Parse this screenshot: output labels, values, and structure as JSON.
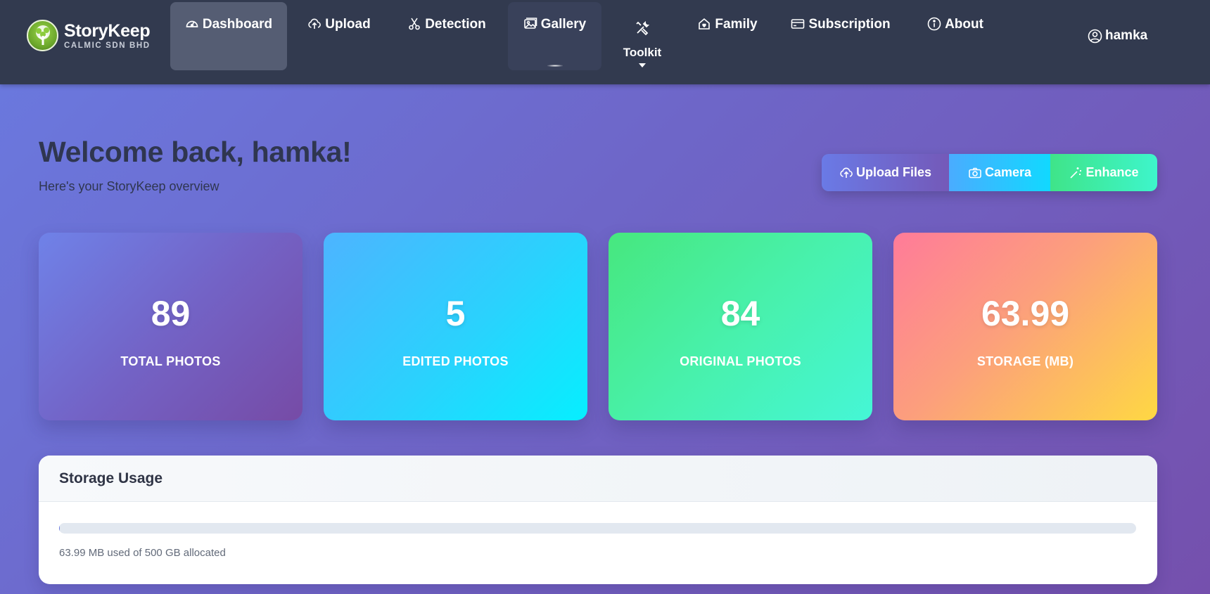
{
  "brand": {
    "name": "StoryKeep",
    "subtitle": "CALMIC SDN BHD",
    "logo_icon": "tree-icon"
  },
  "nav": {
    "items": [
      {
        "label": "Dashboard",
        "icon": "gauge-icon",
        "state": "active"
      },
      {
        "label": "Upload",
        "icon": "cloud-upload-icon"
      },
      {
        "label": "Detection",
        "icon": "scissors-icon"
      },
      {
        "label": "Gallery",
        "icon": "images-icon",
        "state": "hover"
      },
      {
        "label": "Toolkit",
        "icon": "tools-icon",
        "has_dropdown": true
      },
      {
        "label": "Family",
        "icon": "house-heart-icon"
      },
      {
        "label": "Subscription",
        "icon": "credit-card-icon"
      },
      {
        "label": "About",
        "icon": "info-circle-icon"
      }
    ],
    "user": {
      "label": "hamka",
      "icon": "user-circle-icon"
    }
  },
  "welcome": {
    "title": "Welcome back, hamka!",
    "subtitle": "Here's your StoryKeep overview"
  },
  "actions": [
    {
      "label": "Upload Files",
      "icon": "cloud-upload-icon"
    },
    {
      "label": "Camera",
      "icon": "camera-icon"
    },
    {
      "label": "Enhance",
      "icon": "magic-wand-icon"
    }
  ],
  "stats": [
    {
      "value": "89",
      "label": "TOTAL PHOTOS"
    },
    {
      "value": "5",
      "label": "EDITED PHOTOS"
    },
    {
      "value": "84",
      "label": "ORIGINAL PHOTOS"
    },
    {
      "value": "63.99",
      "label": "STORAGE (MB)"
    }
  ],
  "storage": {
    "title": "Storage Usage",
    "used_fraction": 0.0001,
    "note": "63.99 MB used of 500 GB allocated"
  },
  "colors": {
    "navbar": "#323a4f",
    "background_start": "#6a7ae0",
    "background_end": "#7550ad",
    "heading": "#2f3650"
  }
}
